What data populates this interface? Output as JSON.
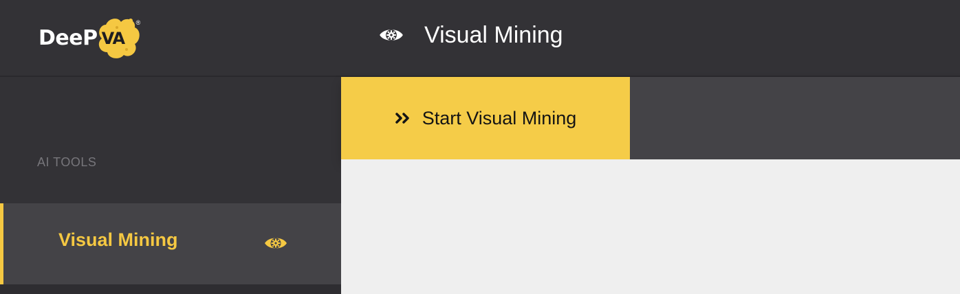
{
  "brand": {
    "logo_text": "DeeP",
    "logo_suffix": "VA",
    "logo_mark": "®",
    "accent_color": "#f5c842"
  },
  "sidebar": {
    "section_label": "AI TOOLS",
    "items": [
      {
        "label": "Visual Mining",
        "icon": "eye-gear-icon",
        "active": true
      }
    ]
  },
  "header": {
    "title": "Visual Mining",
    "icon": "eye-gear-icon"
  },
  "toolbar": {
    "start_label": "Start Visual Mining",
    "start_icon": "double-chevron-right-icon"
  }
}
